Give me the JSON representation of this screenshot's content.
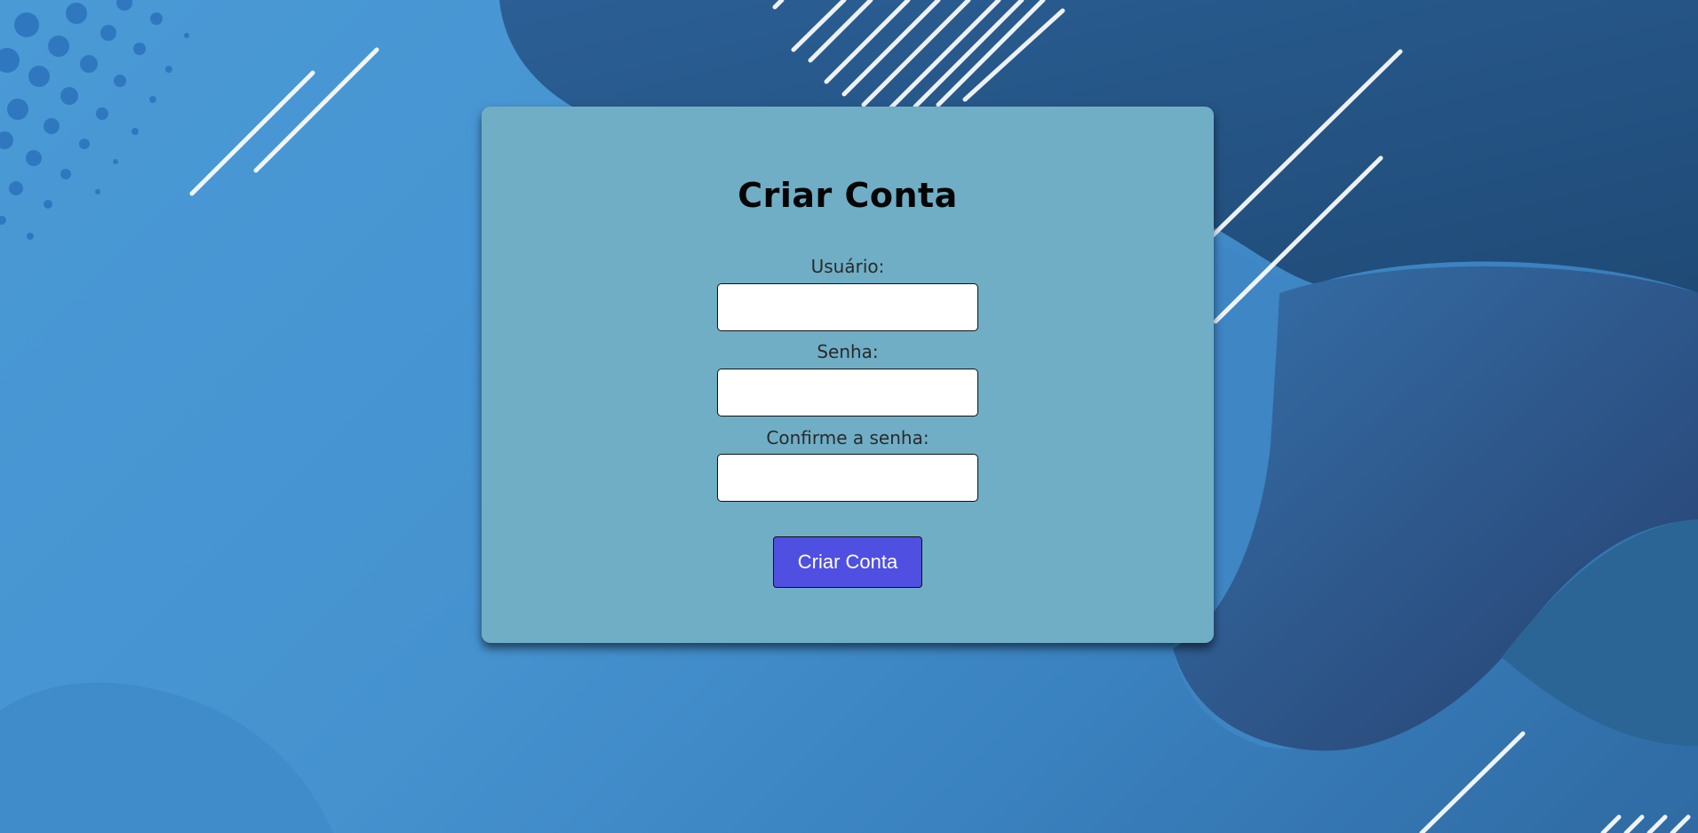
{
  "form": {
    "title": "Criar Conta",
    "fields": [
      {
        "label": "Usuário:",
        "value": ""
      },
      {
        "label": "Senha:",
        "value": ""
      },
      {
        "label": "Confirme a senha:",
        "value": ""
      }
    ],
    "submit_label": "Criar Conta"
  },
  "colors": {
    "background": "#4592cf",
    "card": "#70aec6",
    "button": "#4f4fe2",
    "button_text": "#ffffff"
  }
}
